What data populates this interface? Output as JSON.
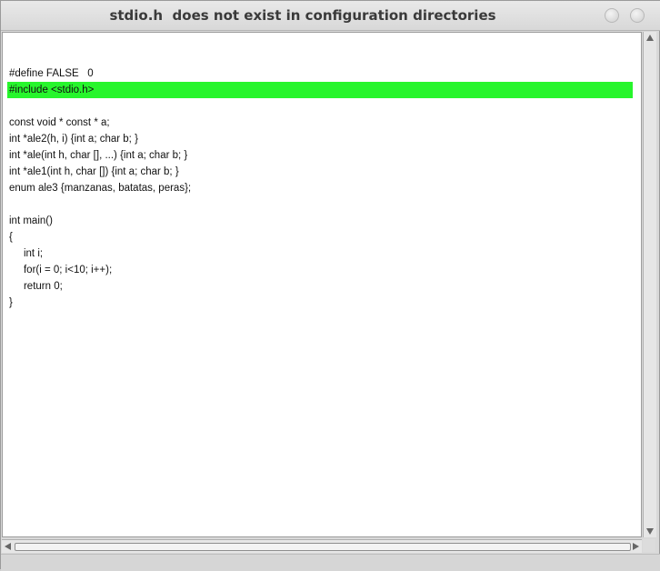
{
  "window": {
    "title": "stdio.h  does not exist in configuration directories"
  },
  "code": {
    "lines": [
      "",
      "#define FALSE   0",
      "#include <stdio.h>",
      "",
      "const void * const * a;",
      "int *ale2(h, i) {int a; char b; }",
      "int *ale(int h, char [], ...) {int a; char b; }",
      "int *ale1(int h, char []) {int a; char b; }",
      "enum ale3 {manzanas, batatas, peras};",
      "",
      "int main()",
      "{",
      "     int i;",
      "     for(i = 0; i<10; i++);",
      "     return 0;",
      "}"
    ],
    "highlighted_line_index": 2,
    "highlight_color": "#27f52c"
  }
}
